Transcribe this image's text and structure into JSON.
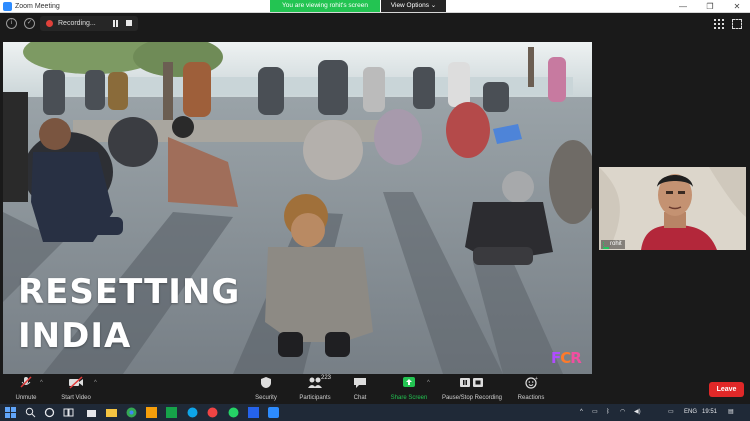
{
  "window": {
    "title": "Zoom Meeting",
    "controls": [
      "—",
      "❐",
      "✕"
    ]
  },
  "meeting_bar": {
    "recording_label": "Recording...",
    "viewing_banner": "You are viewing rohit's screen",
    "view_options_label": "View Options ⌄"
  },
  "shared_screen": {
    "overlay_line1": "RESETTING",
    "overlay_line2": "INDIA",
    "logo_letters": [
      "F",
      "C",
      "R"
    ]
  },
  "participant": {
    "name": "rohit"
  },
  "toolbar": {
    "unmute_label": "Unmute",
    "start_video_label": "Start Video",
    "security_label": "Security",
    "participants_label": "Participants",
    "participants_count": "223",
    "chat_label": "Chat",
    "share_screen_label": "Share Screen",
    "recording_label": "Pause/Stop Recording",
    "reactions_label": "Reactions",
    "leave_label": "Leave"
  },
  "colors": {
    "share_screen_green": "#23c452",
    "leave_red": "#e02828",
    "recording_red": "#e0413a",
    "zoom_blue": "#2d8cff"
  },
  "taskbar": {
    "language": "ENG",
    "time": "19:51"
  }
}
